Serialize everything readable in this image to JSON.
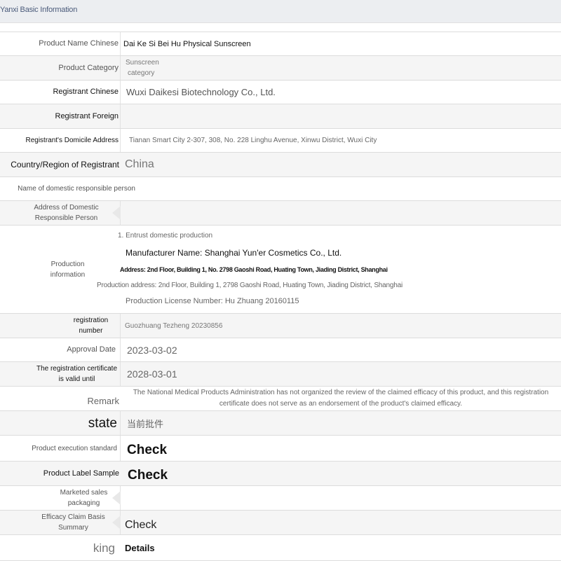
{
  "header": {
    "title": "Yanxi Basic Information"
  },
  "rows": {
    "product_name_chinese": {
      "label": "Product Name Chinese",
      "value": "Dai Ke Si Bei Hu Physical Sunscreen"
    },
    "product_category": {
      "label": "Product Category",
      "value_line1": "Sunscreen",
      "value_line2": "category"
    },
    "registrant_chinese": {
      "label": "Registrant Chinese",
      "value": "Wuxi Daikesi Biotechnology Co., Ltd."
    },
    "registrant_foreign": {
      "label": "Registrant Foreign",
      "value": ""
    },
    "domicile_address": {
      "label": "Registrant's Domicile Address",
      "value": "Tianan Smart City 2-307, 308, No. 228 Linghu Avenue, Xinwu District, Wuxi City"
    },
    "country_region": {
      "label": "Country/Region of Registrant",
      "value": "China"
    },
    "domestic_person": {
      "label": "Name of domestic responsible person",
      "value": ""
    },
    "domestic_address": {
      "label_line1": "Address of Domestic",
      "label_line2": "Responsible Person",
      "value": ""
    },
    "production": {
      "label_line1": "Production",
      "label_line2": "information",
      "entrust": "1. Entrust domestic production",
      "manufacturer": "Manufacturer Name: Shanghai Yun'er Cosmetics Co., Ltd.",
      "address": "Address: 2nd Floor, Building 1, No. 2798 Gaoshi Road, Huating Town, Jiading District, Shanghai",
      "production_address": "Production address: 2nd Floor, Building 1, 2798 Gaoshi Road, Huating Town, Jiading District, Shanghai",
      "license": "Production License Number: Hu Zhuang 20160115"
    },
    "registration_number": {
      "label_line1": "registration",
      "label_line2": "number",
      "value": "Guozhuang Tezheng 20230856"
    },
    "approval_date": {
      "label": "Approval Date",
      "value": "2023-03-02"
    },
    "valid_until": {
      "label_line1": "The registration certificate",
      "label_line2": "is valid until",
      "value": "2028-03-01"
    },
    "remark": {
      "label": "Remark",
      "value_line1": "The National Medical Products Administration has not organized the review of the claimed efficacy of this product, and this registration",
      "value_line2": "certificate does not serve as an endorsement of the product's claimed efficacy."
    },
    "state": {
      "label": "state",
      "value": "当前批件"
    },
    "execution_standard": {
      "label": "Product execution standard",
      "value": "Check"
    },
    "label_sample": {
      "label": "Product Label Sample",
      "value": "Check"
    },
    "sales_packaging": {
      "label_line1": "Marketed sales",
      "label_line2": "packaging",
      "value": ""
    },
    "efficacy_claim": {
      "label_line1": "Efficacy Claim Basis",
      "label_line2": "Summary",
      "value": "Check"
    },
    "king": {
      "label": "king",
      "value": "Details"
    }
  }
}
